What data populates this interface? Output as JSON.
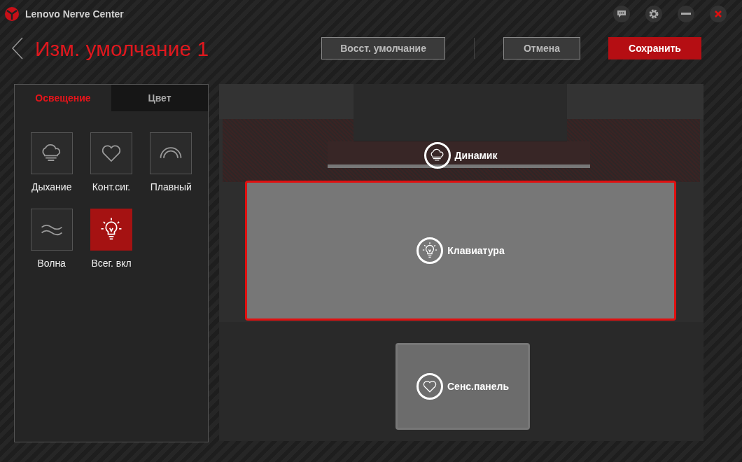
{
  "window": {
    "title": "Lenovo Nerve Center"
  },
  "header": {
    "title": "Изм. умолчание 1",
    "buttons": [
      {
        "label": "Восст. умолчание",
        "kind": "outline"
      },
      {
        "label": "Отмена",
        "kind": "outline"
      },
      {
        "label": "Сохранить",
        "kind": "primary"
      }
    ]
  },
  "tabs": [
    {
      "label": "Освещение",
      "selected": true
    },
    {
      "label": "Цвет",
      "selected": false
    }
  ],
  "effects": [
    {
      "label": "Дыхание",
      "kind": "breathing",
      "selected": false
    },
    {
      "label": "Конт.сиг.",
      "kind": "heartbeat",
      "selected": false
    },
    {
      "label": "Плавный",
      "kind": "smooth",
      "selected": false
    },
    {
      "label": "Волна",
      "kind": "wave",
      "selected": false
    },
    {
      "label": "Всег. вкл",
      "kind": "always_on",
      "selected": true
    }
  ],
  "zones": [
    {
      "label": "Динамик",
      "kind": "breathing",
      "selected": false
    },
    {
      "label": "Клавиатура",
      "kind": "always_on",
      "selected": true
    },
    {
      "label": "Сенс.панель",
      "kind": "heartbeat",
      "selected": false
    }
  ]
}
